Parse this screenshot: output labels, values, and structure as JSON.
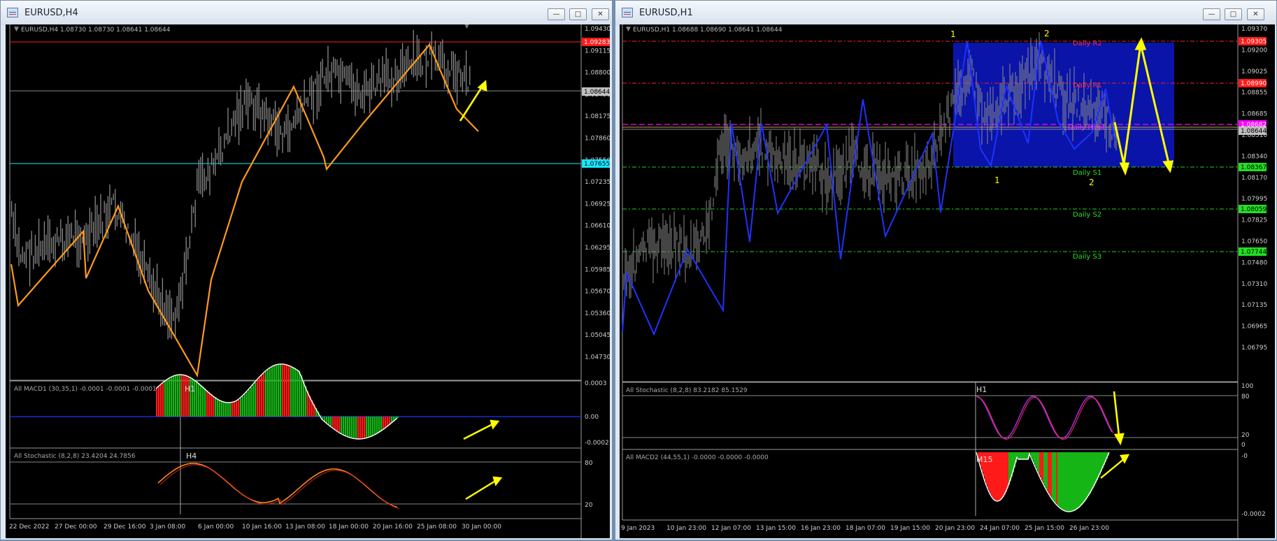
{
  "windows": [
    {
      "title": "EURUSD,H4",
      "buttons": {
        "minimize": "—",
        "maximize": "□",
        "close": "✕"
      },
      "main": {
        "header": "EURUSD,H4  1.08730 1.08730 1.08641 1.08644",
        "price_ticks": [
          "1.09430",
          "1.09115",
          "1.08800",
          "1.08490",
          "1.08175",
          "1.07860",
          "1.07550",
          "1.07235",
          "1.06925",
          "1.06610",
          "1.06295",
          "1.05985",
          "1.05670",
          "1.05360",
          "1.05045",
          "1.04730"
        ],
        "tags": [
          {
            "text": "1.09283",
            "bg": "#ff1a1a",
            "fg": "#ffffff"
          },
          {
            "text": "1.08644",
            "bg": "#c0c0c0",
            "fg": "#000000"
          },
          {
            "text": "1.07655",
            "bg": "#19e6ff",
            "fg": "#000000"
          }
        ]
      },
      "sub1": {
        "header": "All MACD1 (30,35,1) -0.0001 -0.0001 -0.0001",
        "tf": "H1",
        "ticks": [
          "0.0003",
          "0.00",
          "-0.0002"
        ]
      },
      "sub2": {
        "header": "All Stochastic (8,2,8) 23.4204 24.7856",
        "tf": "H4",
        "ticks": [
          "80",
          "20"
        ]
      },
      "time_ticks": [
        "22 Dec 2022",
        "27 Dec 00:00",
        "29 Dec 16:00",
        "3 Jan 08:00",
        "6 Jan 00:00",
        "10 Jan 16:00",
        "13 Jan 08:00",
        "18 Jan 00:00",
        "20 Jan 16:00",
        "25 Jan 08:00",
        "30 Jan 00:00"
      ]
    },
    {
      "title": "EURUSD,H1",
      "buttons": {
        "minimize": "—",
        "maximize": "□",
        "close": "✕"
      },
      "main": {
        "header": "EURUSD,H1  1.08688 1.08690 1.08641 1.08644",
        "price_ticks": [
          "1.09370",
          "1.09200",
          "1.09025",
          "1.08855",
          "1.08685",
          "1.08510",
          "1.08340",
          "1.08170",
          "1.07995",
          "1.07825",
          "1.07650",
          "1.07480",
          "1.07310",
          "1.07135",
          "1.06965",
          "1.06795"
        ],
        "tags": [
          {
            "text": "1.09305",
            "bg": "#ff1a1a",
            "fg": "#ffffff"
          },
          {
            "text": "1.08990",
            "bg": "#ff1a1a",
            "fg": "#ffffff"
          },
          {
            "text": "1.08682",
            "bg": "#ff00ff",
            "fg": "#ffffff"
          },
          {
            "text": "1.08644",
            "bg": "#c0c0c0",
            "fg": "#000000"
          },
          {
            "text": "1.08367",
            "bg": "#22e022",
            "fg": "#000000"
          },
          {
            "text": "1.08059",
            "bg": "#22e022",
            "fg": "#000000"
          },
          {
            "text": "1.07744",
            "bg": "#22e022",
            "fg": "#000000"
          }
        ],
        "pivots": [
          "Daily R2",
          "Daily R1",
          "Daily Pivot",
          "Daily S1",
          "Daily S2",
          "Daily S3"
        ],
        "wave_labels": [
          "1",
          "2",
          "1",
          "2"
        ]
      },
      "sub1": {
        "header": "All Stochastic (8,2,8) 83.2182 85.1529",
        "tf": "H1",
        "ticks": [
          "100",
          "80",
          "20",
          "0"
        ]
      },
      "sub2": {
        "header": "All MACD2 (44,55,1) -0.0000 -0.0000 -0.0000",
        "tf": "M15",
        "ticks": [
          "-0",
          "-0.0002"
        ]
      },
      "time_ticks": [
        "9 Jan 2023",
        "10 Jan 23:00",
        "12 Jan 07:00",
        "13 Jan 15:00",
        "16 Jan 23:00",
        "18 Jan 07:00",
        "19 Jan 15:00",
        "20 Jan 23:00",
        "24 Jan 07:00",
        "25 Jan 15:00",
        "26 Jan 23:00"
      ]
    }
  ],
  "colors": {
    "accent": "#ffff00",
    "zigzag_h4": "#ff9a1a",
    "zigzag_h1": "#1f32ff",
    "box": "#0a14a8"
  }
}
